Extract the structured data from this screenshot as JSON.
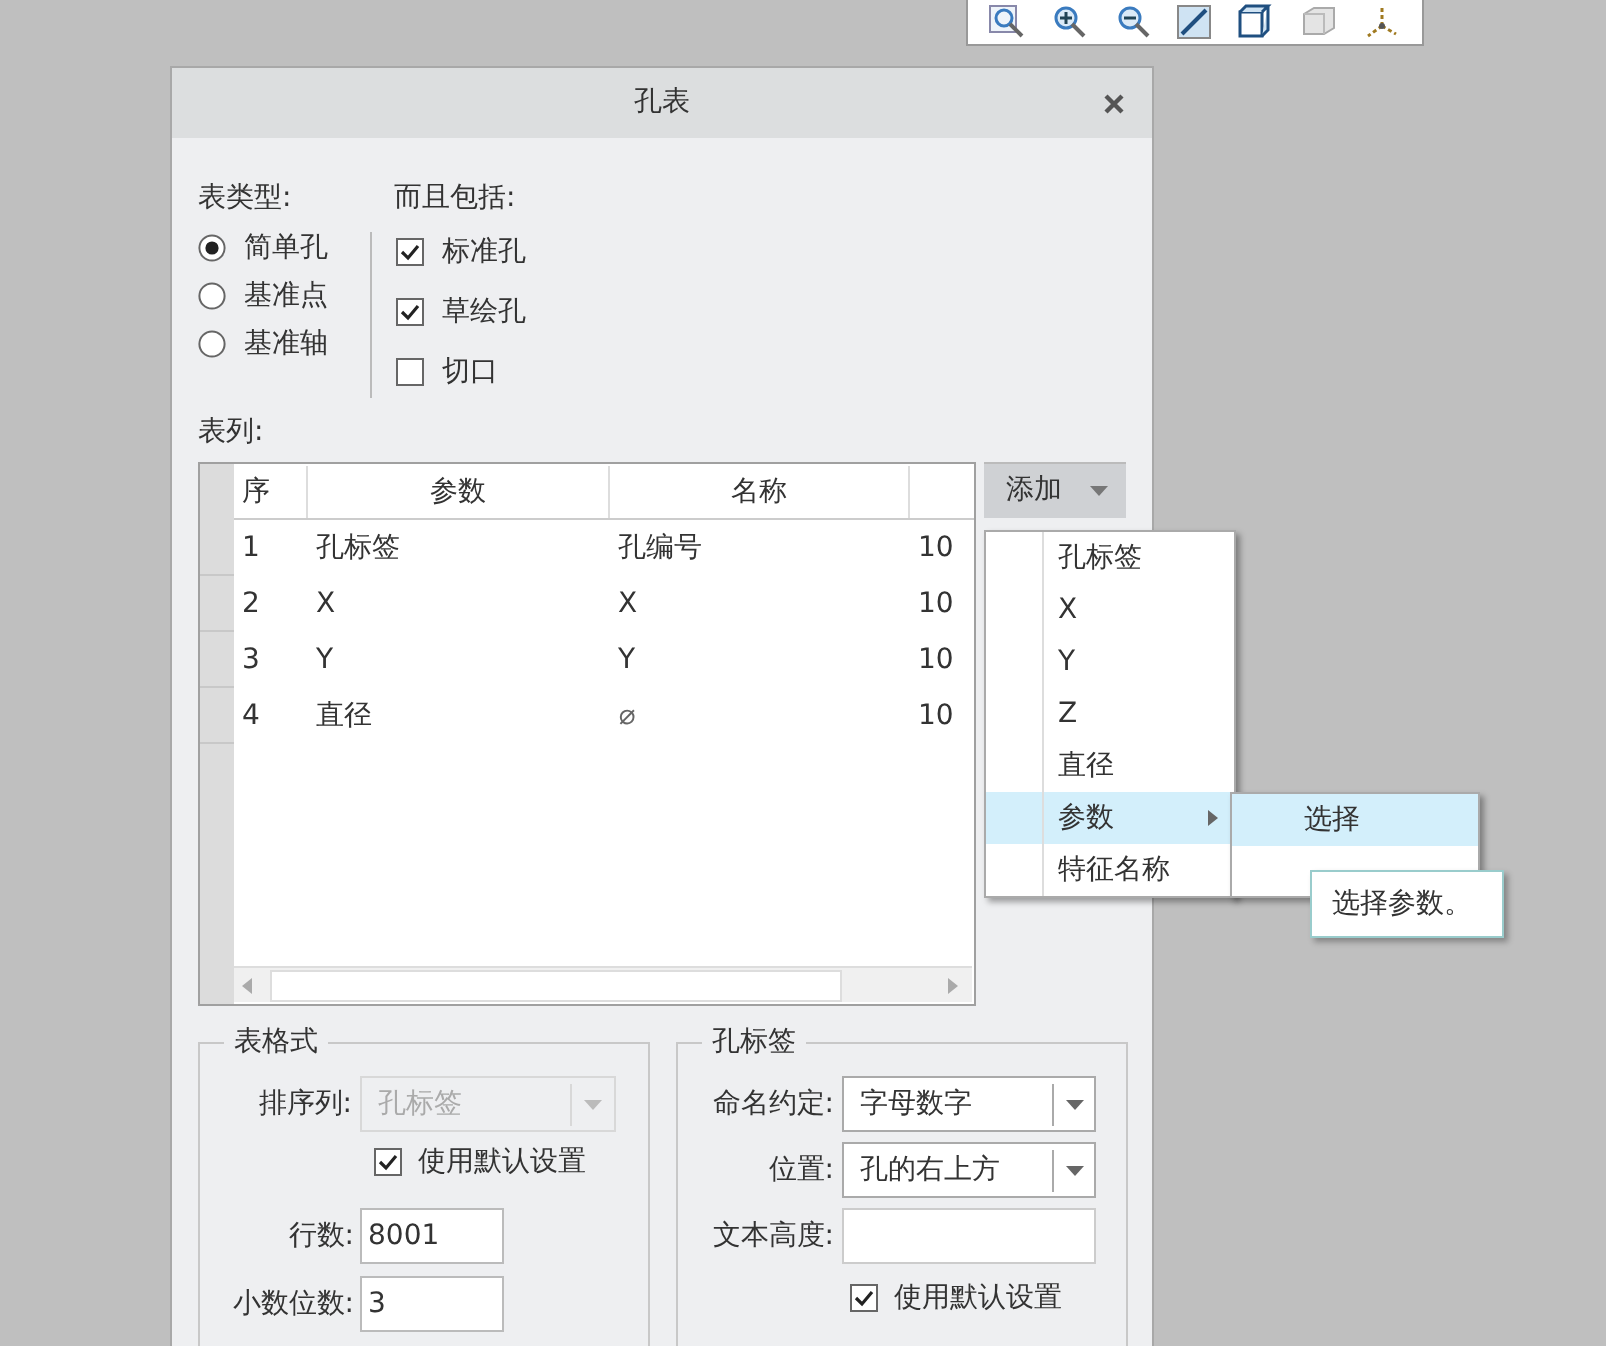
{
  "window": {
    "title": "孔表"
  },
  "table_type": {
    "label": "表类型:",
    "options": [
      {
        "label": "简单孔",
        "selected": true
      },
      {
        "label": "基准点",
        "selected": false
      },
      {
        "label": "基准轴",
        "selected": false
      }
    ]
  },
  "include": {
    "label": "而且包括:",
    "options": [
      {
        "label": "标准孔",
        "checked": true
      },
      {
        "label": "草绘孔",
        "checked": true
      },
      {
        "label": "切口",
        "checked": false
      }
    ]
  },
  "table_columns": {
    "label": "表列:",
    "columns": [
      "序",
      "参数",
      "名称"
    ],
    "rows": [
      [
        "1",
        "孔标签",
        "孔编号",
        "10"
      ],
      [
        "2",
        "X",
        "X",
        "10"
      ],
      [
        "3",
        "Y",
        "Y",
        "10"
      ],
      [
        "4",
        "直径",
        "⌀",
        "10"
      ]
    ]
  },
  "add_button": {
    "label": "添加"
  },
  "add_menu": {
    "items": [
      {
        "label": "孔标签",
        "selected": false,
        "submenu": false
      },
      {
        "label": "X",
        "selected": false,
        "submenu": false
      },
      {
        "label": "Y",
        "selected": false,
        "submenu": false
      },
      {
        "label": "Z",
        "selected": false,
        "submenu": false
      },
      {
        "label": "直径",
        "selected": false,
        "submenu": false
      },
      {
        "label": "参数",
        "selected": true,
        "submenu": true
      },
      {
        "label": "特征名称",
        "selected": false,
        "submenu": false
      }
    ]
  },
  "submenu": {
    "items": [
      {
        "label": "选择",
        "selected": true
      }
    ]
  },
  "tooltip": "选择参数。",
  "table_format": {
    "title": "表格式",
    "sort_label": "排序列:",
    "sort_value": "孔标签",
    "sort_disabled": true,
    "use_default": {
      "label": "使用默认设置",
      "checked": true
    },
    "rows_label": "行数:",
    "rows_value": "8001",
    "decimals_label": "小数位数:",
    "decimals_value": "3"
  },
  "hole_label": {
    "title": "孔标签",
    "naming_label": "命名约定:",
    "naming_value": "字母数字",
    "position_label": "位置:",
    "position_value": "孔的右上方",
    "text_height_label": "文本高度:",
    "use_default": {
      "label": "使用默认设置",
      "checked": true
    }
  }
}
